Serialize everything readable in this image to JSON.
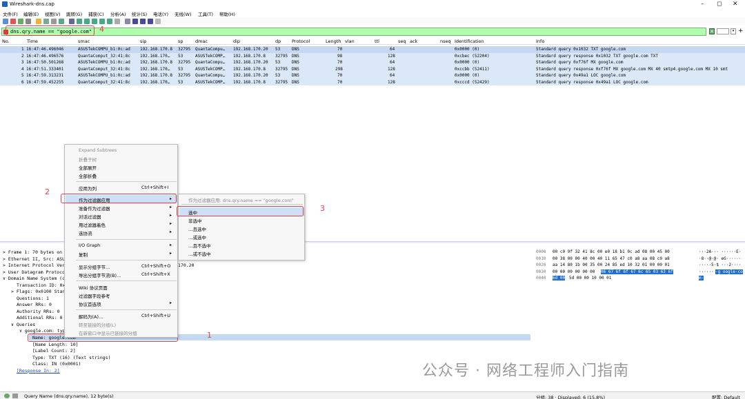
{
  "window": {
    "title": "Wireshark-dns.cap"
  },
  "menu": [
    "文件(F)",
    "编辑(E)",
    "视图(V)",
    "跳转(G)",
    "捕获(C)",
    "分析(A)",
    "统计(S)",
    "电话(Y)",
    "无线(W)",
    "工具(T)",
    "帮助(H)"
  ],
  "filter": {
    "value": "dns.qry.name == \"google.com\""
  },
  "columns": [
    "No.",
    "Time",
    "smac",
    "sip",
    "sp",
    "dmac",
    "dip",
    "dp",
    "Protocol",
    "Length",
    "vlan",
    "ttl",
    "seq",
    "ack",
    "nseq",
    "Identification",
    "Info"
  ],
  "packets": [
    {
      "no": "1",
      "time": "16:47:46.496046",
      "smac": "ASUSTekCOMPU_b1:0c:ad",
      "sip": "192.168.170.8",
      "sp": "32795",
      "dmac": "QuantaCompu…",
      "dip": "192.168.170.20",
      "dp": "53",
      "proto": "DNS",
      "len": "70",
      "ttl": "64",
      "ident": "0x0000 (0)",
      "info": "Standard query 0x1032 TXT google.com"
    },
    {
      "no": "2",
      "time": "16:47:46.496576",
      "smac": "QuantaComput_32:41:8c",
      "sip": "192.168.170…",
      "sp": "53",
      "dmac": "ASUSTekCOMP…",
      "dip": "192.168.170.8",
      "dp": "32795",
      "proto": "DNS",
      "len": "98",
      "ttl": "128",
      "ident": "0xcbec (52204)",
      "info": "Standard query response 0x1032 TXT google.com TXT"
    },
    {
      "no": "3",
      "time": "16:47:50.501268",
      "smac": "ASUSTekCOMPU_b1:0c:ad",
      "sip": "192.168.170.8",
      "sp": "32795",
      "dmac": "QuantaCompu…",
      "dip": "192.168.170.20",
      "dp": "53",
      "proto": "DNS",
      "len": "70",
      "ttl": "64",
      "ident": "0x0000 (0)",
      "info": "Standard query 0xf76f MX google.com"
    },
    {
      "no": "4",
      "time": "16:47:51.333401",
      "smac": "QuantaComput_32:41:8c",
      "sip": "192.168.170…",
      "sp": "53",
      "dmac": "ASUSTekCOMP…",
      "dip": "192.168.170.8",
      "dp": "32795",
      "proto": "DNS",
      "len": "298",
      "ttl": "128",
      "ident": "0xccbb (52411)",
      "info": "Standard query response 0xf76f MX google.com MX 40 smtp4.google.com MX 10 smt"
    },
    {
      "no": "5",
      "time": "16:47:59.313231",
      "smac": "ASUSTekCOMPU_b1:0c:ad",
      "sip": "192.168.170.8",
      "sp": "32795",
      "dmac": "QuantaCompu…",
      "dip": "192.168.170.20",
      "dp": "53",
      "proto": "DNS",
      "len": "70",
      "ttl": "64",
      "ident": "0x0000 (0)",
      "info": "Standard query 0x49a1 LOC google.com"
    },
    {
      "no": "6",
      "time": "16:47:59.452255",
      "smac": "QuantaComput_32:41:8c",
      "sip": "192.168.170…",
      "sp": "53",
      "dmac": "ASUSTekCOMP…",
      "dip": "192.168.170.8",
      "dp": "32795",
      "proto": "DNS",
      "len": "70",
      "ttl": "128",
      "ident": "0xcccd (52429)",
      "info": "Standard query response 0x49a1 LOC google.com"
    }
  ],
  "details": [
    "Frame 1: 70 bytes on",
    "Ethernet II, Src: ASU",
    "Internet Protocol Ver",
    "User Datagram Protoco",
    "Domain Name System (c",
    "Transaction ID: 0x",
    "Flags: 0x0100 Star",
    "Questions: 1",
    "Answer RRs: 0",
    "Authority RRs: 0",
    "Additional RRs: 0",
    "Queries",
    "google.com: typ",
    "Name: google.com",
    "[Name Length: 10]",
    "[Label Count: 2]",
    "Type: TXT (16) (Text strings)",
    "Class: IN (0x0001)",
    "[Response In: 2]"
  ],
  "detail_extra": "170.20",
  "hex": {
    "offsets": [
      "0000",
      "0010",
      "0020",
      "0030",
      "0040"
    ],
    "bytes": [
      "00 c0 9f 32 41 8c 00 e0  18 b1 0c ad 08 00 45 00",
      "00 38 00 00 40 00 40 11  65 47 c0 a8 aa 08 c0 a8",
      "aa 14 80 1b 00 35 00 24  85 ed 10 32 01 00 00 01",
      "00 00 00 00 00 00",
      "5d 00 00 10 00 01"
    ],
    "bytes_hl": [
      "06 67  6f 6f 67 6c 65 03 63 6f",
      "6d 00"
    ],
    "ascii": [
      "···2A··· ······E·",
      "·8··@·@· eG······",
      "·····5·$ ···2····",
      "······",
      "··"
    ],
    "ascii_hl": [
      "·g oogle·co",
      "m·"
    ]
  },
  "context_menu": {
    "items": [
      "Expand Subtrees",
      "折叠子树",
      "全部展开",
      "全部折叠",
      "应用为列",
      "作为过滤器应用",
      "准备作为过滤器",
      "对话过滤器",
      "用过滤器着色",
      "选协流",
      "I/O Graph",
      "复制",
      "显示分组字节...",
      "导出分组字节流(B)...",
      "Wiki 协议页面",
      "过滤器字段参考",
      "协议首选项",
      "解码为(A)...",
      "转至链接的分组(L)",
      "在新窗口中显示已链接的分组"
    ],
    "shortcuts": {
      "apply_col": "Ctrl+Shift+I",
      "show_bytes": "Ctrl+Shift+O",
      "export_bytes": "Ctrl+Shift+X",
      "decode_as": "Ctrl+Shift+U"
    }
  },
  "submenu": {
    "header": "作为过滤器应用: dns.qry.name == \"google.com\"",
    "items": [
      "选中",
      "非选中",
      "…且选中",
      "…或选中",
      "…且不选中",
      "…或不选中"
    ]
  },
  "callouts": [
    "1",
    "2",
    "3",
    "4"
  ],
  "status": {
    "field": "Query Name (dns.qry.name), 12 byte(s)",
    "counts": "分组: 38 · Displayed: 6 (15.8%)",
    "profile": "配置: Default"
  },
  "watermark": "公众号 · 网络工程师入门指南"
}
